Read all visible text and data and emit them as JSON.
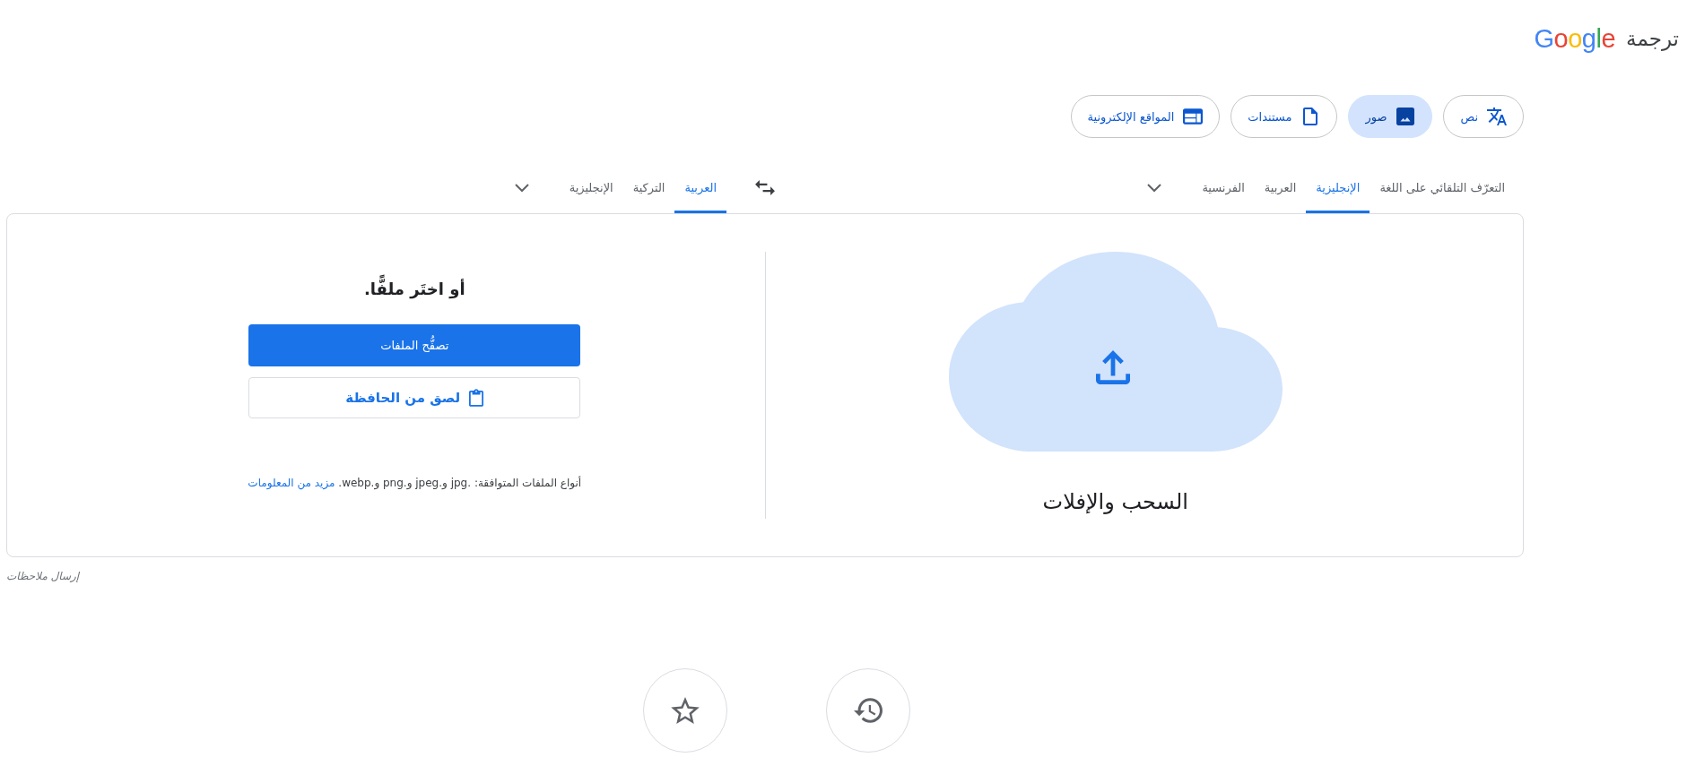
{
  "header": {
    "product_name": "ترجمة",
    "logo_text": "Google"
  },
  "modes": [
    {
      "kind": "text",
      "label": "نص",
      "selected": false
    },
    {
      "kind": "images",
      "label": "صور",
      "selected": true
    },
    {
      "kind": "documents",
      "label": "مستندات",
      "selected": false
    },
    {
      "kind": "websites",
      "label": "المواقع الإلكترونية",
      "selected": false
    }
  ],
  "source_languages": {
    "tabs": [
      {
        "label": "التعرّف التلقائي على اللغة",
        "selected": false
      },
      {
        "label": "الإنجليزية",
        "selected": true
      },
      {
        "label": "العربية",
        "selected": false
      },
      {
        "label": "الفرنسية",
        "selected": false
      }
    ]
  },
  "target_languages": {
    "tabs": [
      {
        "label": "العربية",
        "selected": true
      },
      {
        "label": "التركية",
        "selected": false
      },
      {
        "label": "الإنجليزية",
        "selected": false
      }
    ]
  },
  "upload": {
    "drop_label": "السحب والإفلات",
    "choose_heading": "أو اختَر ملفًّا.",
    "browse_button": "تصفُّح الملفات",
    "paste_button": "لصق من الحافظة",
    "file_types_note": "أنواع الملفات المتوافقة: .jpg و.jpeg و.png و.webp.",
    "learn_more_link": "مزيد من المعلومات"
  },
  "feedback_link": "إرسال ملاحظات"
}
